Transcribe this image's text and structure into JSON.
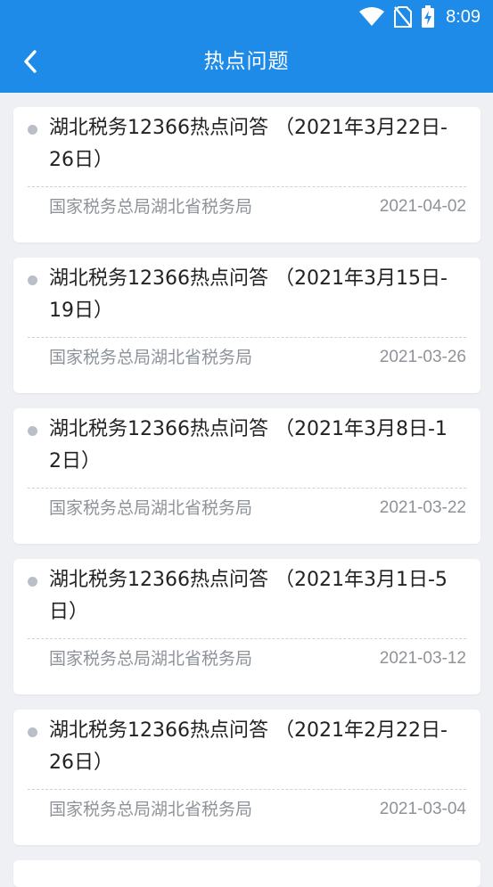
{
  "status_bar": {
    "time": "8:09",
    "icons": [
      "wifi-icon",
      "no-sim-icon",
      "battery-charging-icon"
    ]
  },
  "header": {
    "back_icon": "chevron-left-icon",
    "title": "热点问题"
  },
  "colors": {
    "header_bg": "#1e8be8",
    "page_bg": "#eef0f4",
    "title_text": "#222222",
    "meta_text": "#8e9399",
    "dot": "#b9bec8"
  },
  "articles": [
    {
      "title": "湖北税务12366热点问答 （2021年3月22日-26日）",
      "source": "国家税务总局湖北省税务局",
      "date": "2021-04-02"
    },
    {
      "title": "湖北税务12366热点问答 （2021年3月15日-19日）",
      "source": "国家税务总局湖北省税务局",
      "date": "2021-03-26"
    },
    {
      "title": "湖北税务12366热点问答 （2021年3月8日-12日）",
      "source": "国家税务总局湖北省税务局",
      "date": "2021-03-22"
    },
    {
      "title": "湖北税务12366热点问答 （2021年3月1日-5日）",
      "source": "国家税务总局湖北省税务局",
      "date": "2021-03-12"
    },
    {
      "title": "湖北税务12366热点问答 （2021年2月22日-26日）",
      "source": "国家税务总局湖北省税务局",
      "date": "2021-03-04"
    }
  ]
}
